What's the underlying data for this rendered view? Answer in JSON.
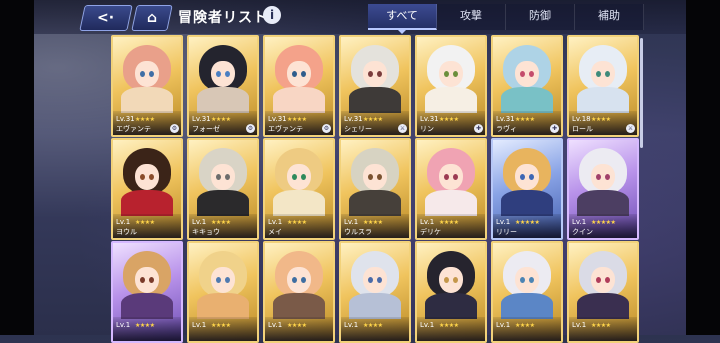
{
  "header": {
    "title": "冒険者リスト",
    "back_icon": "back-arrow-icon",
    "home_icon": "home-icon",
    "info_label": "i"
  },
  "tabs": [
    {
      "label": "すべて",
      "active": true
    },
    {
      "label": "攻撃",
      "active": false
    },
    {
      "label": "防御",
      "active": false
    },
    {
      "label": "補助",
      "active": false
    }
  ],
  "characters": [
    {
      "level": "Lv.31",
      "stars": "★★★★",
      "name": "エヴァンテ",
      "rarity": "gold",
      "hair": "#e9a08a",
      "body": "#f2d9b8",
      "eyes": "#3f6ea5",
      "badge": "⚙"
    },
    {
      "level": "Lv.31",
      "stars": "★★★★",
      "name": "フォーゼ",
      "rarity": "gold",
      "hair": "#24242e",
      "body": "#d8c7b6",
      "eyes": "#4a7fc2",
      "badge": "⚙"
    },
    {
      "level": "Lv.31",
      "stars": "★★★★",
      "name": "エヴァンテ",
      "rarity": "gold",
      "hair": "#f4a28a",
      "body": "#f8d6c4",
      "eyes": "#2f5d8c",
      "badge": "⚙"
    },
    {
      "level": "Lv.31",
      "stars": "★★★★",
      "name": "シェリー",
      "rarity": "gold",
      "hair": "#e4e2dc",
      "body": "#3e3a38",
      "eyes": "#7a3c3c",
      "badge": "⚔"
    },
    {
      "level": "Lv.31",
      "stars": "★★★★",
      "name": "リン",
      "rarity": "gold",
      "hair": "#f2f2f2",
      "body": "#f6efe4",
      "eyes": "#6b8f3c",
      "badge": "✚"
    },
    {
      "level": "Lv.31",
      "stars": "★★★★",
      "name": "ラヴィ",
      "rarity": "gold",
      "hair": "#aed3e6",
      "body": "#79c1c6",
      "eyes": "#c44c6b",
      "badge": "✚"
    },
    {
      "level": "Lv.18",
      "stars": "★★★★",
      "name": "ロール",
      "rarity": "gold",
      "hair": "#e7edf5",
      "body": "#d7e2ef",
      "eyes": "#3e8a7a",
      "badge": "⚔"
    },
    {
      "level": "Lv.1",
      "stars": "★★★★",
      "name": "ヨウル",
      "rarity": "gold",
      "hair": "#3b2418",
      "body": "#b8222e",
      "eyes": "#8a4c2a",
      "badge": ""
    },
    {
      "level": "Lv.1",
      "stars": "★★★★",
      "name": "キキョウ",
      "rarity": "gold",
      "hair": "#d9d4c6",
      "body": "#2b2a2c",
      "eyes": "#6c6c6c",
      "badge": ""
    },
    {
      "level": "Lv.1",
      "stars": "★★★★",
      "name": "メイ",
      "rarity": "gold",
      "hair": "#eecb82",
      "body": "#f3e6c6",
      "eyes": "#2f8a5c",
      "badge": ""
    },
    {
      "level": "Lv.1",
      "stars": "★★★★",
      "name": "ウルスラ",
      "rarity": "gold",
      "hair": "#d7d3c2",
      "body": "#46403a",
      "eyes": "#7a5230",
      "badge": ""
    },
    {
      "level": "Lv.1",
      "stars": "★★★★",
      "name": "デリケ",
      "rarity": "gold",
      "hair": "#f0a3b3",
      "body": "#f6e9ea",
      "eyes": "#9c3a52",
      "badge": ""
    },
    {
      "level": "Lv.1",
      "stars": "★★★★★",
      "name": "リリー",
      "rarity": "blue",
      "hair": "#e8b45e",
      "body": "#2f3e7e",
      "eyes": "#3e67b4",
      "badge": ""
    },
    {
      "level": "Lv.1",
      "stars": "★★★★★",
      "name": "クイン",
      "rarity": "purple",
      "hair": "#ecebf2",
      "body": "#4c3e62",
      "eyes": "#a1406a",
      "badge": ""
    },
    {
      "level": "Lv.1",
      "stars": "★★★★",
      "name": "",
      "rarity": "purple",
      "hair": "#d9a465",
      "body": "#5a3a7a",
      "eyes": "#7a3a2a",
      "badge": ""
    },
    {
      "level": "Lv.1",
      "stars": "★★★★",
      "name": "",
      "rarity": "gold",
      "hair": "#f0d28a",
      "body": "#e9b070",
      "eyes": "#4f7ab0",
      "badge": ""
    },
    {
      "level": "Lv.1",
      "stars": "★★★★",
      "name": "",
      "rarity": "gold",
      "hair": "#f1b889",
      "body": "#7a5a48",
      "eyes": "#3e6ea2",
      "badge": ""
    },
    {
      "level": "Lv.1",
      "stars": "★★★★",
      "name": "",
      "rarity": "gold",
      "hair": "#dfe3ec",
      "body": "#b6c0d6",
      "eyes": "#4a6aa8",
      "badge": ""
    },
    {
      "level": "Lv.1",
      "stars": "★★★★",
      "name": "",
      "rarity": "gold",
      "hair": "#26242e",
      "body": "#2e2c42",
      "eyes": "#c4974a",
      "badge": ""
    },
    {
      "level": "Lv.1",
      "stars": "★★★★",
      "name": "",
      "rarity": "gold",
      "hair": "#ecebf2",
      "body": "#5b86c6",
      "eyes": "#4c84b4",
      "badge": ""
    },
    {
      "level": "Lv.1",
      "stars": "★★★★",
      "name": "",
      "rarity": "gold",
      "hair": "#dadbe6",
      "body": "#3a2f50",
      "eyes": "#b03c5a",
      "badge": ""
    }
  ]
}
